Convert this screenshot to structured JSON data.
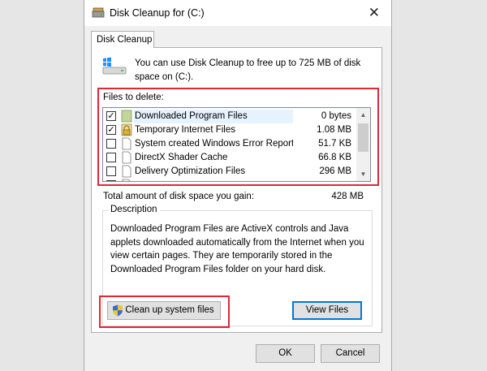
{
  "window": {
    "title": "Disk Cleanup for  (C:)"
  },
  "tab": {
    "label": "Disk Cleanup"
  },
  "intro": "You can use Disk Cleanup to free up to 725 MB of disk space on  (C:).",
  "files_label": "Files to delete:",
  "files": [
    {
      "name": "Downloaded Program Files",
      "size": "0 bytes",
      "checked": true,
      "icon": "folder-icon",
      "selected": true
    },
    {
      "name": "Temporary Internet Files",
      "size": "1.08 MB",
      "checked": true,
      "icon": "lock-folder-icon",
      "selected": false
    },
    {
      "name": "System created Windows Error Reporti...",
      "size": "51.7 KB",
      "checked": false,
      "icon": "file-icon",
      "selected": false
    },
    {
      "name": "DirectX Shader Cache",
      "size": "66.8 KB",
      "checked": false,
      "icon": "file-icon",
      "selected": false
    },
    {
      "name": "Delivery Optimization Files",
      "size": "296 MB",
      "checked": false,
      "icon": "file-icon",
      "selected": false
    }
  ],
  "total": {
    "label": "Total amount of disk space you gain:",
    "value": "428 MB"
  },
  "description": {
    "title": "Description",
    "text": "Downloaded Program Files are ActiveX controls and Java applets downloaded automatically from the Internet when you view certain pages. They are temporarily stored in the Downloaded Program Files folder on your hard disk."
  },
  "buttons": {
    "cleanup": "Clean up system files",
    "view_files": "View Files",
    "ok": "OK",
    "cancel": "Cancel"
  },
  "colors": {
    "highlight_box": "#e32636",
    "default_button_border": "#0078d7",
    "selection": "#e5f3ff"
  }
}
